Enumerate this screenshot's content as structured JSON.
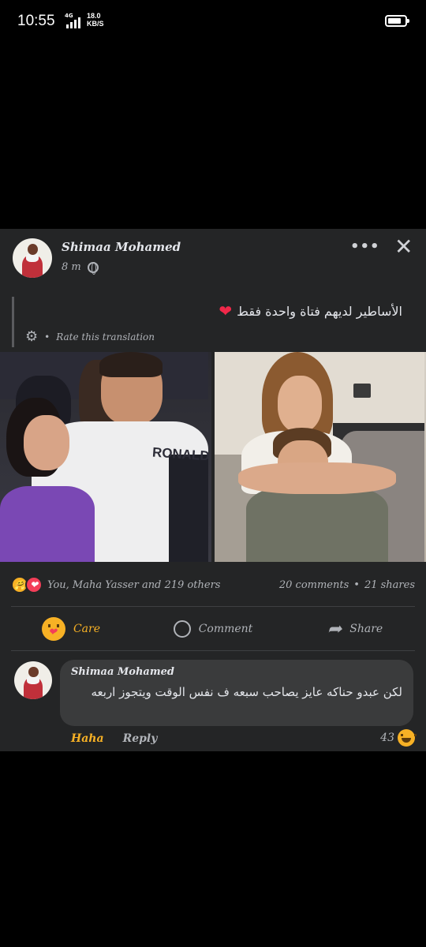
{
  "status_bar": {
    "time": "10:55",
    "network": "4G",
    "speed_value": "18.0",
    "speed_unit": "KB/S",
    "battery_level": 0.8
  },
  "post": {
    "author": "Shimaa Mohamed",
    "time": "8 m",
    "privacy_icon": "globe-icon",
    "text": "الأساطير لديهم فتاة واحدة فقط",
    "text_emoji": "❤️",
    "translation_label": "Rate this translation",
    "photo_overlay_text": "RONALD",
    "reactions": {
      "summary": "You, Maha Yasser and 219 others",
      "icons": [
        "care-emoji-icon",
        "love-heart-icon"
      ]
    },
    "stats": {
      "comments": "20 comments",
      "separator": "•",
      "shares": "21 shares"
    },
    "actions": {
      "care": "Care",
      "comment": "Comment",
      "share": "Share"
    }
  },
  "comment": {
    "author": "Shimaa Mohamed",
    "text": "لكن عبدو حناكه عايز يصاحب سبعه ف نفس الوقت ويتجوز اربعه",
    "reaction_label": "Haha",
    "reply_label": "Reply",
    "reaction_count": "43"
  },
  "colors": {
    "card_bg": "#242526",
    "comment_bg": "#3a3b3c",
    "care_yellow": "#f7b125",
    "heart_red": "#f02849"
  }
}
